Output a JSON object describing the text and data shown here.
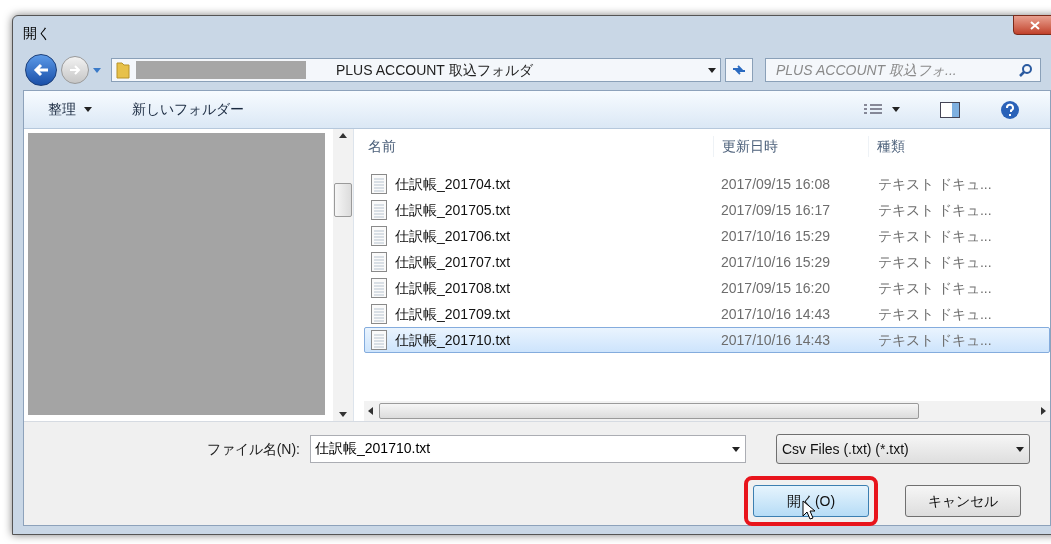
{
  "window": {
    "title": "開く"
  },
  "address_bar": {
    "path": "PLUS ACCOUNT 取込フォルダ"
  },
  "search": {
    "placeholder": "PLUS ACCOUNT 取込フォ..."
  },
  "toolbar": {
    "organize": "整理",
    "new_folder": "新しいフォルダー"
  },
  "columns": [
    "名前",
    "更新日時",
    "種類"
  ],
  "files": [
    {
      "name": "仕訳帳_201704.txt",
      "modified": "2017/09/15 16:08",
      "type": "テキスト ドキュ...",
      "selected": false
    },
    {
      "name": "仕訳帳_201705.txt",
      "modified": "2017/09/15 16:17",
      "type": "テキスト ドキュ...",
      "selected": false
    },
    {
      "name": "仕訳帳_201706.txt",
      "modified": "2017/10/16 15:29",
      "type": "テキスト ドキュ...",
      "selected": false
    },
    {
      "name": "仕訳帳_201707.txt",
      "modified": "2017/10/16 15:29",
      "type": "テキスト ドキュ...",
      "selected": false
    },
    {
      "name": "仕訳帳_201708.txt",
      "modified": "2017/09/15 16:20",
      "type": "テキスト ドキュ...",
      "selected": false
    },
    {
      "name": "仕訳帳_201709.txt",
      "modified": "2017/10/16 14:43",
      "type": "テキスト ドキュ...",
      "selected": false
    },
    {
      "name": "仕訳帳_201710.txt",
      "modified": "2017/10/16 14:43",
      "type": "テキスト ドキュ...",
      "selected": true
    }
  ],
  "file_name": {
    "label": "ファイル名(N):",
    "value": "仕訳帳_201710.txt"
  },
  "file_type": {
    "value": "Csv Files (.txt) (*.txt)"
  },
  "buttons": [
    {
      "label": "開く(O)",
      "highlighted": true
    },
    {
      "label": "キャンセル",
      "highlighted": false
    }
  ]
}
